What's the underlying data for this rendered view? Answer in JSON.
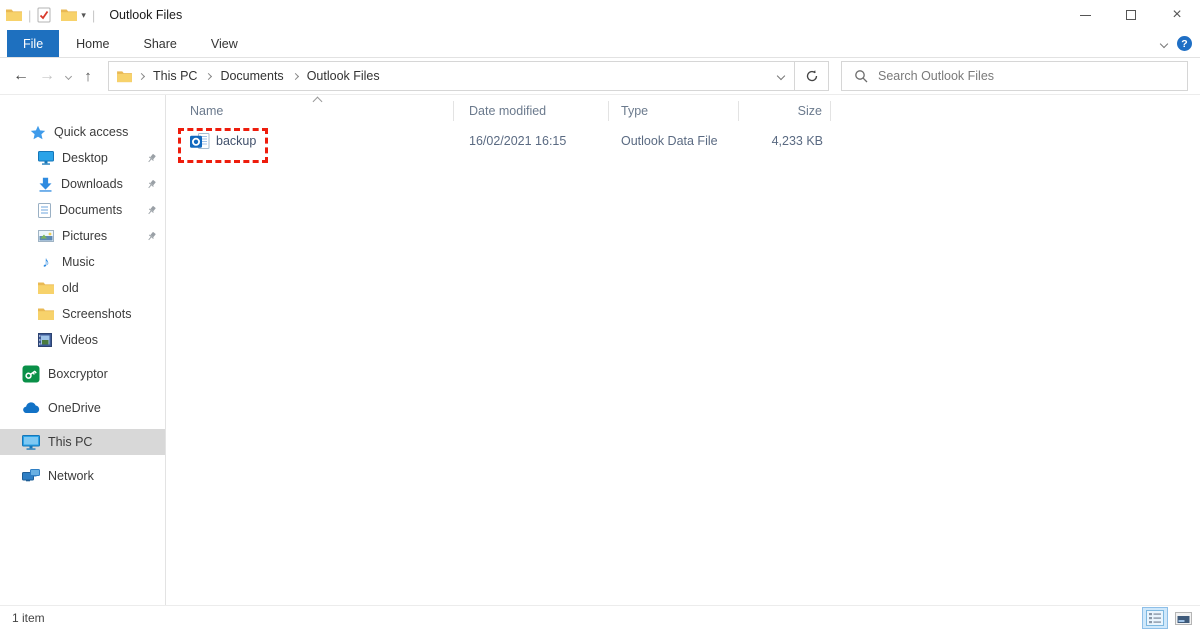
{
  "window": {
    "title": "Outlook Files"
  },
  "ribbon": {
    "tabs": [
      "File",
      "Home",
      "Share",
      "View"
    ]
  },
  "toolbar": {
    "breadcrumb": [
      "This PC",
      "Documents",
      "Outlook Files"
    ],
    "search_placeholder": "Search Outlook Files"
  },
  "file_list": {
    "columns": [
      "Name",
      "Date modified",
      "Type",
      "Size"
    ],
    "rows": [
      {
        "name": "backup",
        "date_modified": "16/02/2021 16:15",
        "type": "Outlook Data File",
        "size": "4,233 KB"
      }
    ]
  },
  "sidebar": {
    "items": [
      {
        "label": "Quick access"
      },
      {
        "label": "Desktop",
        "pinned": true
      },
      {
        "label": "Downloads",
        "pinned": true
      },
      {
        "label": "Documents",
        "pinned": true
      },
      {
        "label": "Pictures",
        "pinned": true
      },
      {
        "label": "Music"
      },
      {
        "label": "old"
      },
      {
        "label": "Screenshots"
      },
      {
        "label": "Videos"
      },
      {
        "label": "Boxcryptor"
      },
      {
        "label": "OneDrive"
      },
      {
        "label": "This PC",
        "selected": true
      },
      {
        "label": "Network"
      }
    ]
  },
  "status_bar": {
    "items_count": "1 item"
  },
  "colors": {
    "accent-blue": "#1e70bf",
    "annotation-red": "#ee1c0c",
    "folder-yellow": "#f7d26b",
    "selection-grey": "#d8d8d8",
    "help-blue": "#1f6fc5"
  }
}
